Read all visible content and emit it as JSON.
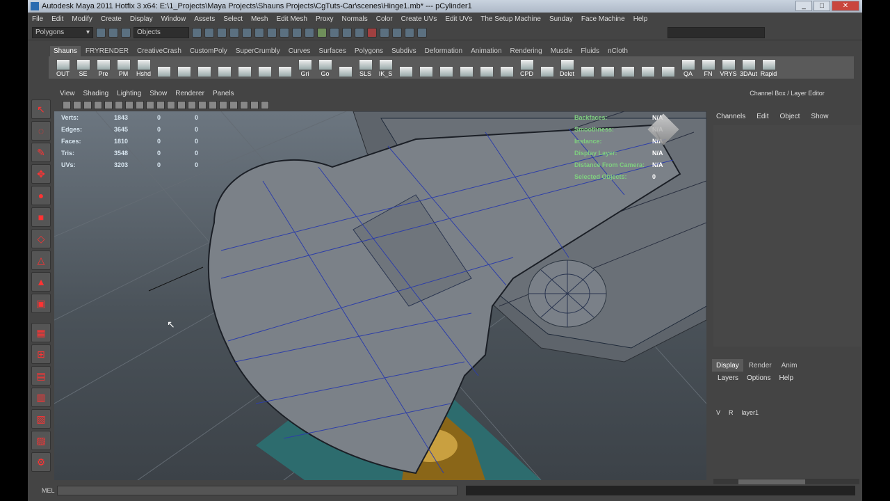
{
  "window": {
    "title": "Autodesk Maya 2011 Hotfix 3 x64: E:\\1_Projects\\Maya Projects\\Shauns Projects\\CgTuts-Car\\scenes\\Hinge1.mb*  ---  pCylinder1"
  },
  "menubar": [
    "File",
    "Edit",
    "Modify",
    "Create",
    "Display",
    "Window",
    "Assets",
    "Select",
    "Mesh",
    "Edit Mesh",
    "Proxy",
    "Normals",
    "Color",
    "Create UVs",
    "Edit UVs",
    "The Setup Machine",
    "Sunday",
    "Face Machine",
    "Help"
  ],
  "statusline": {
    "mode": "Polygons",
    "objects": "Objects"
  },
  "shelf_tabs": [
    "Shauns",
    "FRYRENDER",
    "CreativeCrash",
    "CustomPoly",
    "SuperCrumbly",
    "Curves",
    "Surfaces",
    "Polygons",
    "Subdivs",
    "Deformation",
    "Animation",
    "Rendering",
    "Muscle",
    "Fluids",
    "nCloth"
  ],
  "shelf_buttons": [
    "OUT",
    "SE",
    "Pre",
    "PM",
    "Hshd",
    "",
    "",
    "",
    "",
    "",
    "",
    "",
    "Gri",
    "Go",
    "",
    "SLS",
    "IK_S",
    "",
    "",
    "",
    "",
    "",
    "",
    "CPD",
    "",
    "Delet",
    "",
    "",
    "",
    "",
    "",
    "QA",
    "FN",
    "VRYS",
    "3DAut",
    "Rapid"
  ],
  "panel_menu": [
    "View",
    "Shading",
    "Lighting",
    "Show",
    "Renderer",
    "Panels"
  ],
  "hud_left": [
    {
      "k": "Verts:",
      "v": "1843",
      "a": "0",
      "b": "0"
    },
    {
      "k": "Edges:",
      "v": "3645",
      "a": "0",
      "b": "0"
    },
    {
      "k": "Faces:",
      "v": "1810",
      "a": "0",
      "b": "0"
    },
    {
      "k": "Tris:",
      "v": "3548",
      "a": "0",
      "b": "0"
    },
    {
      "k": "UVs:",
      "v": "3203",
      "a": "0",
      "b": "0"
    }
  ],
  "hud_right": [
    {
      "k": "Backfaces:",
      "v": "N/A"
    },
    {
      "k": "Smoothness:",
      "v": "N/A"
    },
    {
      "k": "Instance:",
      "v": "N/A"
    },
    {
      "k": "Display Layer:",
      "v": "N/A"
    },
    {
      "k": "Distance From Camera:",
      "v": "N/A"
    },
    {
      "k": "Selected Objects:",
      "v": "0"
    }
  ],
  "channel_box": {
    "header": "Channel Box / Layer Editor",
    "menu": [
      "Channels",
      "Edit",
      "Object",
      "Show"
    ]
  },
  "layer_editor": {
    "tabs": [
      "Display",
      "Render",
      "Anim"
    ],
    "menu": [
      "Layers",
      "Options",
      "Help"
    ],
    "layer": {
      "v": "V",
      "r": "R",
      "name": "layer1"
    }
  },
  "cmdline": {
    "label": "MEL"
  }
}
